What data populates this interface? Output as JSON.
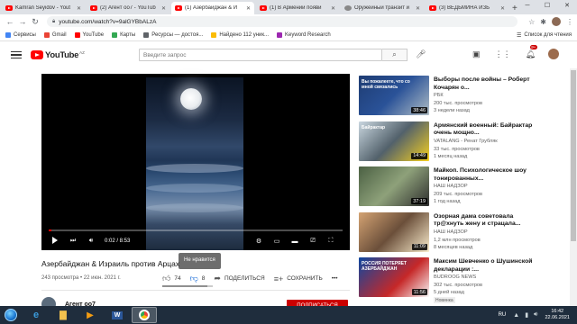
{
  "browser": {
    "tabs": [
      {
        "title": "Kamran Seyidov - Yout",
        "icon": "youtube",
        "active": false
      },
      {
        "title": "(2) Агент оо7 - YouTub",
        "icon": "youtube",
        "active": false
      },
      {
        "title": "(1) Азербайджан & И",
        "icon": "youtube",
        "active": true
      },
      {
        "title": "(1) В Армении появи",
        "icon": "youtube",
        "active": false
      },
      {
        "title": "Оружейный транзит и",
        "icon": "globe",
        "active": false
      },
      {
        "title": "(3) ВЕДЬМИНА ИЗБ",
        "icon": "youtube",
        "active": false
      }
    ],
    "new_tab": "+",
    "url": "youtube.com/watch?v=9alGYBbALzA",
    "bookmarks": [
      {
        "label": "Сервисы",
        "color": "#4285f4"
      },
      {
        "label": "Gmail",
        "color": "#ea4335"
      },
      {
        "label": "YouTube",
        "color": "#ff0000"
      },
      {
        "label": "Карты",
        "color": "#34a853"
      },
      {
        "label": "Ресурсы — достоя...",
        "color": "#5f6368"
      },
      {
        "label": "Найдено 112 уник...",
        "color": "#fbbc05"
      },
      {
        "label": "Keyword Research",
        "color": "#9c27b0"
      }
    ],
    "reading_list": "Список для чтения"
  },
  "youtube": {
    "logo_text": "YouTube",
    "logo_country": "AZ",
    "search_placeholder": "Введите запрос",
    "notification_count": "9+",
    "video": {
      "current_time": "0:02",
      "duration": "8:53",
      "time_display": "0:02 / 8:53",
      "progress": 0.004,
      "title": "Азербайджан & Израиль против Арцах",
      "views": "243 просмотра",
      "date": "22 июн. 2021 г.",
      "meta": "243 просмотра • 22 июн. 2021 г.",
      "likes": "74",
      "dislikes": "8",
      "like_ratio": 0.9,
      "share_label": "ПОДЕЛИТЬСЯ",
      "save_label": "СОХРАНИТЬ",
      "more_label": "•••",
      "dislike_tooltip": "Не нравится"
    },
    "channel": {
      "name": "Агент оо7",
      "subscribe_label": "ПОДПИСАТЬСЯ"
    },
    "recommendations": [
      {
        "title": "Выборы после войны – Роберт Кочарян о...",
        "channel": "РБК",
        "views": "200 тыс. просмотров",
        "when": "3 недели назад",
        "duration": "38:46",
        "thumb_text": "Вы пожалеете, что со мной связались"
      },
      {
        "title": "Армянский военный: Байрактар очень мощно...",
        "channel": "VATALANG - Ренат Грубляк",
        "views": "33 тыс. просмотров",
        "when": "1 месяц назад",
        "duration": "14:49",
        "thumb_text": "Байрактар"
      },
      {
        "title": "Майкоп. Психологическое шоу тонированных...",
        "channel": "НАШ НАДЗОР",
        "views": "209 тыс. просмотров",
        "when": "1 год назад",
        "duration": "37:19",
        "thumb_text": ""
      },
      {
        "title": "Озорная дама советовала тр@хнуть жену и страцала...",
        "channel": "НАШ НАДЗОР",
        "views": "1,2 млн просмотров",
        "when": "8 месяцев назад",
        "duration": "11:09",
        "thumb_text": ""
      },
      {
        "title": "Максим Шевченко о Шушинской декларации :...",
        "channel": "BUDROOG NEWS",
        "views": "302 тыс. просмотров",
        "when": "5 дней назад",
        "duration": "11:56",
        "thumb_text": "РОССИЯ ПОТЕРЯЕТ АЗЕРБАЙДЖАН",
        "badge": "Новинка"
      }
    ]
  },
  "taskbar": {
    "language": "RU",
    "time": "16:42",
    "date": "22.06.2021"
  }
}
